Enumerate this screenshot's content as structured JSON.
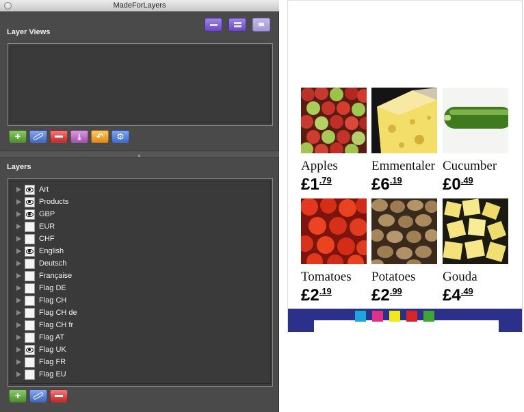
{
  "window": {
    "title": "MadeForLayers"
  },
  "layer_views": {
    "label": "Layer Views"
  },
  "layers": {
    "label": "Layers",
    "items": [
      {
        "name": "Art",
        "visible": true
      },
      {
        "name": "Products",
        "visible": true
      },
      {
        "name": "GBP",
        "visible": true
      },
      {
        "name": "EUR",
        "visible": false
      },
      {
        "name": "CHF",
        "visible": false
      },
      {
        "name": "English",
        "visible": true
      },
      {
        "name": "Deutsch",
        "visible": false
      },
      {
        "name": "Française",
        "visible": false
      },
      {
        "name": "Flag DE",
        "visible": false
      },
      {
        "name": "Flag CH",
        "visible": false
      },
      {
        "name": "Flag CH de",
        "visible": false
      },
      {
        "name": "Flag CH fr",
        "visible": false
      },
      {
        "name": "Flag AT",
        "visible": false
      },
      {
        "name": "Flag UK",
        "visible": true
      },
      {
        "name": "Flag FR",
        "visible": false
      },
      {
        "name": "Flag EU",
        "visible": false
      }
    ]
  },
  "preview": {
    "products": [
      {
        "name": "Apples",
        "currency": "£",
        "whole": "1",
        "pence": "79"
      },
      {
        "name": "Emmentaler",
        "currency": "£",
        "whole": "6",
        "pence": "19"
      },
      {
        "name": "Cucumber",
        "currency": "£",
        "whole": "0",
        "pence": "49"
      },
      {
        "name": "Tomatoes",
        "currency": "£",
        "whole": "2",
        "pence": "19"
      },
      {
        "name": "Potatoes",
        "currency": "£",
        "whole": "2",
        "pence": "99"
      },
      {
        "name": "Gouda",
        "currency": "£",
        "whole": "4",
        "pence": "49"
      }
    ],
    "footer_colors": [
      "#1ea5dc",
      "#e0308a",
      "#f3e818",
      "#d6262a",
      "#3fa535"
    ],
    "footer_bar_color": "#2b318b"
  }
}
